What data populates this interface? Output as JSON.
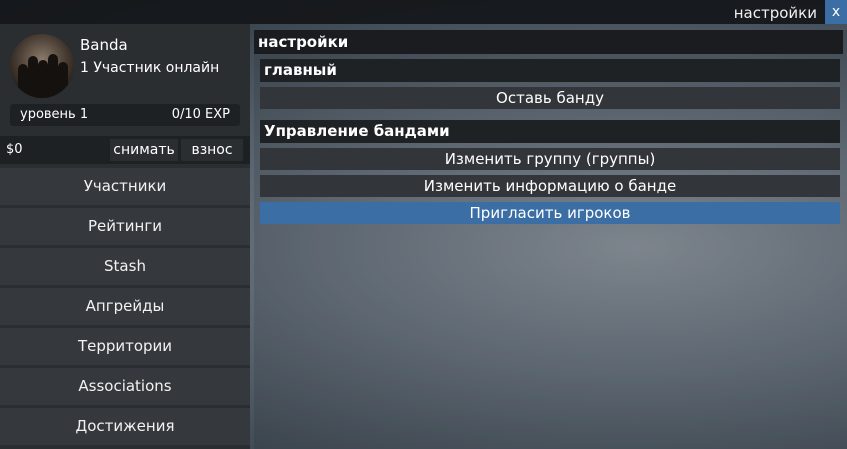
{
  "window": {
    "title": "настройки",
    "close_label": "x"
  },
  "profile": {
    "gang_name": "Banda",
    "online_text": "1 Участник онлайн",
    "level_label": "уровень 1",
    "exp_label": "0/10 EXP"
  },
  "money": {
    "amount": "$0",
    "withdraw_label": "снимать",
    "deposit_label": "взнос"
  },
  "menu": {
    "items": [
      {
        "label": "Участники"
      },
      {
        "label": "Рейтинги"
      },
      {
        "label": "Stash"
      },
      {
        "label": "Апгрейды"
      },
      {
        "label": "Территории"
      },
      {
        "label": "Associations"
      },
      {
        "label": "Достижения"
      }
    ]
  },
  "main": {
    "title": "настройки",
    "sections": [
      {
        "title": "главный",
        "actions": [
          {
            "label": "Оставь банду"
          }
        ]
      },
      {
        "title": "Управление бандами",
        "actions": [
          {
            "label": "Изменить группу (группы)"
          },
          {
            "label": "Изменить информацию о банде"
          },
          {
            "label": "Пригласить игроков"
          }
        ]
      }
    ]
  },
  "colors": {
    "accent": "#3a6ea5",
    "panel": "#2b2e31",
    "dark": "#1a1c1f"
  }
}
